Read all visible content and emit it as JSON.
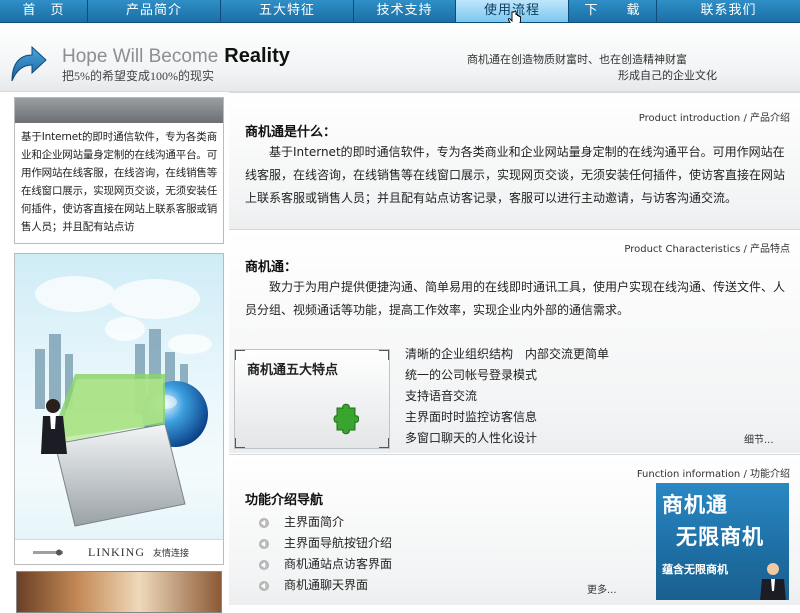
{
  "nav": {
    "items": [
      {
        "label": "首　页"
      },
      {
        "label": "产品简介"
      },
      {
        "label": "五大特征"
      },
      {
        "label": "技术支持"
      },
      {
        "label": "使用流程"
      },
      {
        "label": "下　　载"
      },
      {
        "label": "联系我们"
      }
    ],
    "active_index": 4
  },
  "banner": {
    "slogan_en_light": "Hope Will Become",
    "slogan_en_bold": "Reality",
    "slogan_cn": "把5%的希望变成100%的现实",
    "tagline_1": "商机通在创造物质财富时、也在创造精神财富",
    "tagline_2": "形成自己的企业文化"
  },
  "left": {
    "intro_text": "基于Internet的即时通信软件，专为各类商业和企业网站量身定制的在线沟通平台。可用作网站在线客服，在线咨询，在线销售等在线窗口展示，实现网页交谈，无须安装任何插件，使访客直接在网站上联系客服或销售人员；并且配有站点访",
    "linking_en": "LINKING",
    "linking_cn": "友情连接"
  },
  "sections": {
    "intro": {
      "label": "Product introduction / 产品介绍",
      "title": "商机通是什么：",
      "body": "基于Internet的即时通信软件，专为各类商业和企业网站量身定制的在线沟通平台。可用作网站在线客服，在线咨询，在线销售等在线窗口展示，实现网页交谈，无须安装任何插件，使访客直接在网站上联系客服或销售人员；并且配有站点访客记录，客服可以进行主动邀请，与访客沟通交流。"
    },
    "characteristics": {
      "label": "Product Characteristics / 产品特点",
      "title": "商机通：",
      "body": "致力于为用户提供便捷沟通、简单易用的在线即时通讯工具，使用户实现在线沟通、传送文件、人员分组、视频通话等功能，提高工作效率，实现企业内外部的通信需求。",
      "card_title": "商机通五大特点",
      "features": [
        "清晰的企业组织结构　内部交流更简单",
        "统一的公司帐号登录模式",
        "支持语音交流",
        "主界面时时监控访客信息",
        "多窗口聊天的人性化设计"
      ],
      "detail_link": "细节..."
    },
    "function": {
      "label": "Function information / 功能介绍",
      "title": "功能介绍导航",
      "items": [
        "主界面简介",
        "主界面导航按钮介绍",
        "商机通站点访客界面",
        "商机通聊天界面"
      ],
      "more_link": "更多...",
      "ad_line1": "商机通",
      "ad_line2": "无限商机",
      "ad_line3": "蕴含无限商机"
    }
  },
  "colors": {
    "nav_bg": "#1b6fa5",
    "nav_active": "#9fd6f4",
    "puzzle_green": "#3aa52e"
  }
}
